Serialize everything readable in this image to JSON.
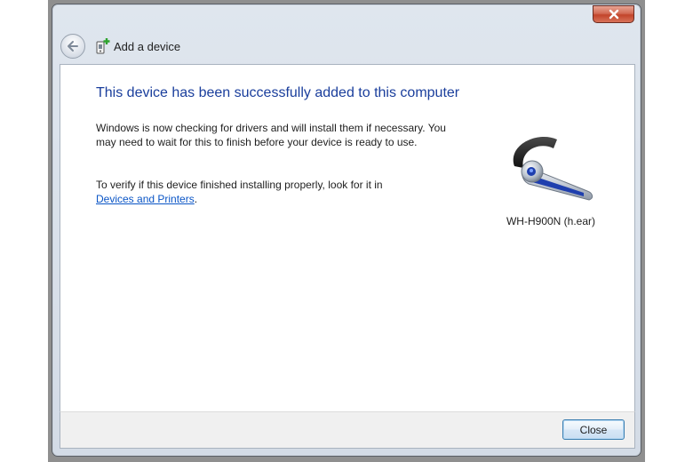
{
  "window": {
    "title": "Add a device",
    "icons": {
      "back": "back-arrow-icon",
      "title": "add-device-icon",
      "close": "close-x-icon",
      "device": "headset-icon"
    }
  },
  "content": {
    "heading": "This device has been successfully added to this computer",
    "paragraph1": "Windows is now checking for drivers and will install them if necessary. You may need to wait for this to finish before your device is ready to use.",
    "paragraph2_text": "To verify if this device finished installing properly, look for it in",
    "paragraph2_link": "Devices and Printers",
    "paragraph2_suffix": ".",
    "device_name": "WH-H900N (h.ear)"
  },
  "footer": {
    "close_label": "Close"
  },
  "colors": {
    "heading": "#1a3e9c",
    "link": "#0a55c6",
    "close_x": "#c2442a"
  }
}
